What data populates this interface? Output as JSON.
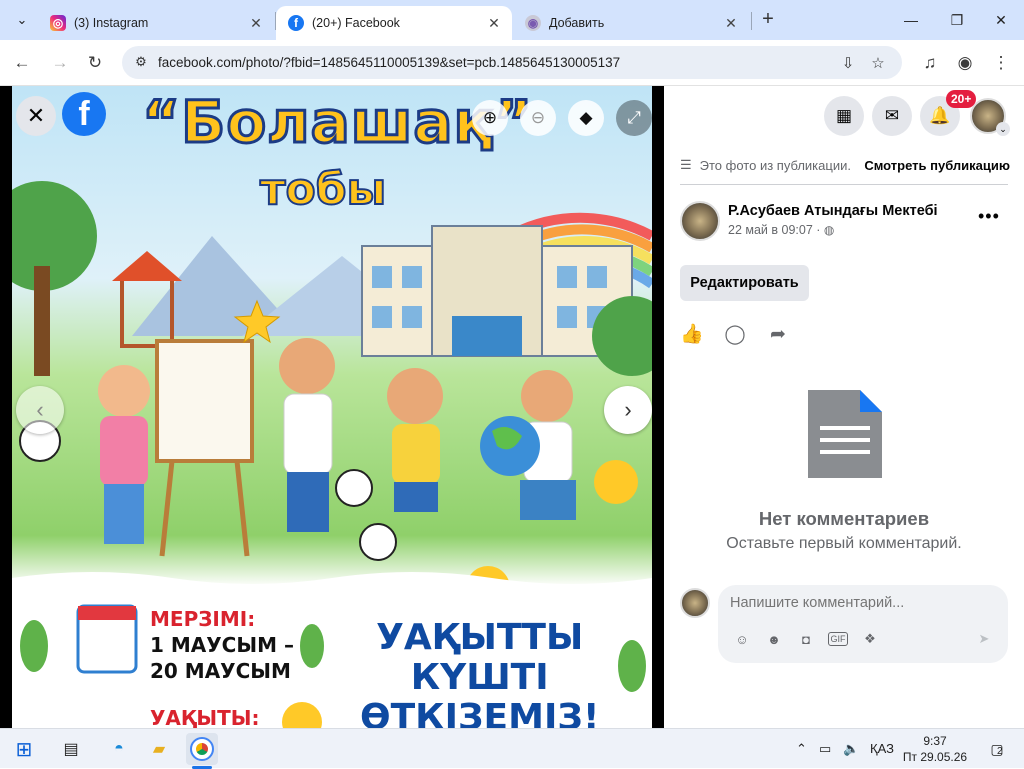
{
  "browser": {
    "tabs": [
      {
        "title": "(3) Instagram",
        "icon": "instagram-icon",
        "active": false
      },
      {
        "title": "(20+) Facebook",
        "icon": "facebook-icon",
        "active": true
      },
      {
        "title": "Добавить",
        "icon": "globe-icon",
        "active": false
      }
    ],
    "url": "facebook.com/photo/?fbid=1485645110005139&set=pcb.1485645130005137"
  },
  "viewer": {
    "poster": {
      "title": "“Болашақ”",
      "subtitle": "тобы",
      "deadline_label": "МЕРЗІМІ:",
      "deadline_line1": "1 МАУСЫМ –",
      "deadline_line2": "20 МАУСЫМ",
      "time_label": "УАҚЫТЫ:",
      "slogan_line1": "УАҚЫТТЫ",
      "slogan_line2": "КҮШТІ",
      "slogan_line3": "ӨТКІЗЕМІЗ!"
    }
  },
  "header": {
    "notifications_badge": "20+"
  },
  "post": {
    "notice": "Это фото из публикации.",
    "view_post": "Смотреть публикацию",
    "author": "Р.Асубаев Атындағы Мектебі",
    "date": "22 май в 09:07 ·",
    "edit_label": "Редактировать",
    "no_comments_title": "Нет комментариев",
    "no_comments_sub": "Оставьте первый комментарий.",
    "comment_placeholder": "Напишите комментарий..."
  },
  "taskbar": {
    "language": "ҚАЗ",
    "time": "9:37",
    "date": "Пт 29.05.26",
    "notification_count": "2"
  },
  "colors": {
    "facebook_blue": "#1877f2",
    "badge_red": "#e41e3f",
    "tab_strip": "#d3e3fd"
  }
}
